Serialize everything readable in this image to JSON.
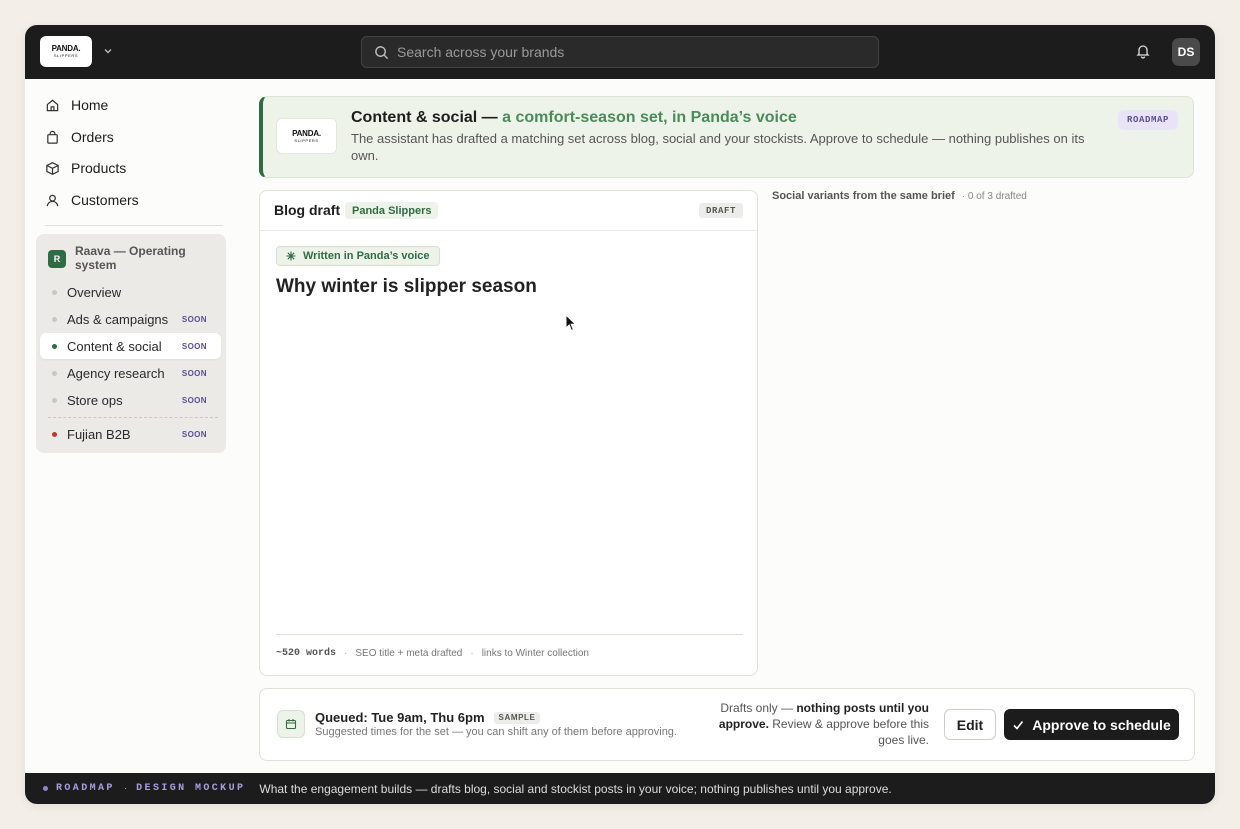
{
  "topbar": {
    "logo_line1": "PANDA.",
    "logo_line2": "SLIPPERS",
    "search_placeholder": "Search across your brands",
    "avatar_initials": "DS"
  },
  "sidebar": {
    "nav": [
      {
        "label": "Home",
        "icon": "home-icon"
      },
      {
        "label": "Orders",
        "icon": "shopping-bag-icon"
      },
      {
        "label": "Products",
        "icon": "box-icon"
      },
      {
        "label": "Customers",
        "icon": "user-icon"
      }
    ],
    "raava": {
      "badge": "R",
      "title": "Raava — Operating system",
      "items": [
        {
          "label": "Overview",
          "soon": ""
        },
        {
          "label": "Ads & campaigns",
          "soon": "SOON"
        },
        {
          "label": "Content & social",
          "soon": "SOON",
          "active": true
        },
        {
          "label": "Agency research",
          "soon": "SOON"
        },
        {
          "label": "Store ops",
          "soon": "SOON"
        },
        {
          "label": "Fujian B2B",
          "soon": "SOON"
        }
      ]
    }
  },
  "hero": {
    "title_lead": "Content & social —",
    "title_accent": "a comfort-season set, in Panda’s voice",
    "description": "The assistant has drafted a matching set across blog, social and your stockists. Approve to schedule — nothing publishes on its own.",
    "badge": "ROADMAP"
  },
  "blog": {
    "header_title": "Blog draft",
    "brand": "Panda Slippers",
    "status": "DRAFT",
    "voice_label": "Written in Panda’s voice",
    "post_title": "Why winter is slipper season",
    "words": "~520 words",
    "seo": "SEO title + meta drafted",
    "links": "links to Winter collection"
  },
  "social": {
    "title": "Social variants from the same brief",
    "count": "· 0 of 3 drafted"
  },
  "queue": {
    "title": "Queued: Tue 9am, Thu 6pm",
    "sample": "SAMPLE",
    "subtitle": "Suggested times for the set — you can shift any of them before approving.",
    "note_lead": "Drafts only —",
    "note_bold": "nothing posts until you approve.",
    "note_tail": "Review & approve before this goes live.",
    "edit_label": "Edit",
    "approve_label": "Approve to schedule"
  },
  "footer": {
    "tag1": "ROADMAP",
    "sep": "·",
    "tag2": "DESIGN MOCKUP",
    "message": "What the engagement builds — drafts blog, social and stockist posts in your voice; nothing publishes until you approve."
  },
  "colors": {
    "brand_green": "#2f6b43",
    "accent_green": "#4a8b5a",
    "roadmap_purple": "#5a4f9a",
    "topbar": "#1c1c1c"
  }
}
